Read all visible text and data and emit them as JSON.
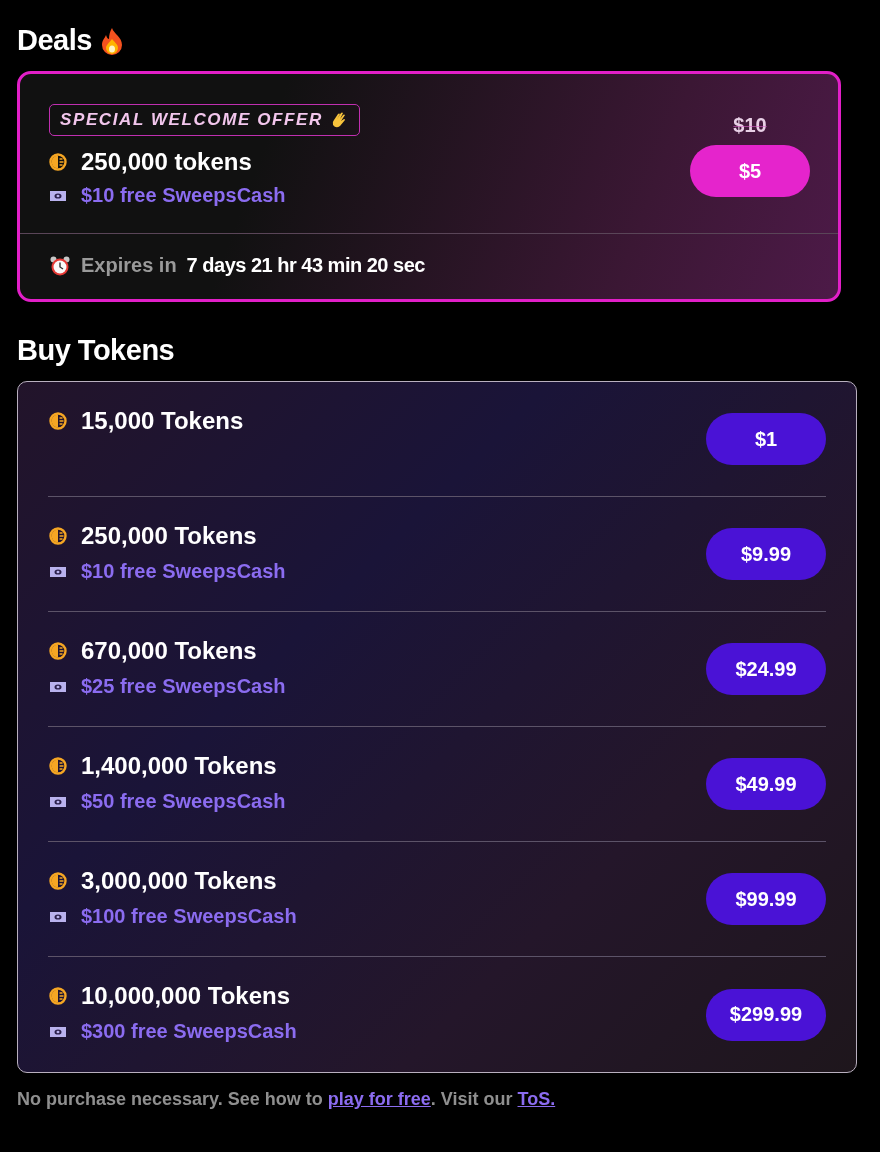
{
  "deals": {
    "title": "Deals",
    "offer": {
      "badge": "SPECIAL WELCOME OFFER",
      "tokens": "250,000 tokens",
      "sweeps": "$10 free SweepsCash",
      "old_price": "$10",
      "price": "$5",
      "expires_label": "Expires in",
      "countdown": "7 days 21 hr 43 min 20 sec"
    }
  },
  "buy": {
    "title": "Buy Tokens",
    "packages": [
      {
        "tokens": "15,000 Tokens",
        "price": "$1"
      },
      {
        "tokens": "250,000 Tokens",
        "sweeps": "$10 free SweepsCash",
        "price": "$9.99"
      },
      {
        "tokens": "670,000 Tokens",
        "sweeps": "$25 free SweepsCash",
        "price": "$24.99"
      },
      {
        "tokens": "1,400,000 Tokens",
        "sweeps": "$50 free SweepsCash",
        "price": "$49.99"
      },
      {
        "tokens": "3,000,000 Tokens",
        "sweeps": "$100 free SweepsCash",
        "price": "$99.99"
      },
      {
        "tokens": "10,000,000 Tokens",
        "sweeps": "$300 free SweepsCash",
        "price": "$299.99"
      }
    ]
  },
  "footer": {
    "parts": [
      {
        "kind": "text",
        "text": "No purchase necessary. See how to "
      },
      {
        "kind": "link",
        "text": "play for free"
      },
      {
        "kind": "text",
        "text": ". Visit our "
      },
      {
        "kind": "link",
        "text": "ToS."
      }
    ]
  }
}
